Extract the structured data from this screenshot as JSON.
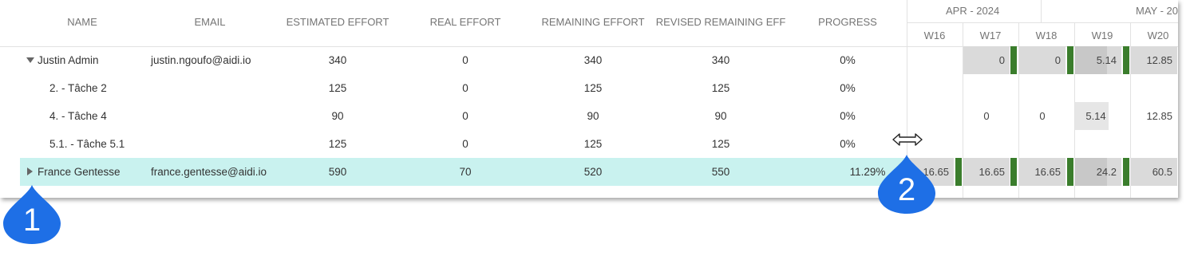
{
  "columns": {
    "name": "NAME",
    "email": "EMAIL",
    "estimated": "ESTIMATED EFFORT",
    "real": "REAL EFFORT",
    "remaining": "REMAINING EFFORT",
    "revised": "REVISED REMAINING EFF",
    "progress": "PROGRESS"
  },
  "gantt": {
    "months": [
      "APR - 2024",
      "MAY - 20"
    ],
    "weeks": [
      "W16",
      "W17",
      "W18",
      "W19",
      "W20"
    ]
  },
  "rows": [
    {
      "name": "Justin Admin",
      "email": "justin.ngoufo@aidi.io",
      "estimated": "340",
      "real": "0",
      "remaining": "340",
      "revised": "340",
      "progress": "0%",
      "gantt": [
        "",
        "0",
        "0",
        "5.14",
        "12.85"
      ]
    },
    {
      "name": "2. - Tâche 2",
      "email": "",
      "estimated": "125",
      "real": "0",
      "remaining": "125",
      "revised": "125",
      "progress": "0%",
      "gantt": [
        "",
        "",
        "",
        "",
        ""
      ]
    },
    {
      "name": "4. - Tâche 4",
      "email": "",
      "estimated": "90",
      "real": "0",
      "remaining": "90",
      "revised": "90",
      "progress": "0%",
      "gantt": [
        "",
        "0",
        "0",
        "5.14",
        "12.85"
      ]
    },
    {
      "name": "5.1. - Tâche 5.1",
      "email": "",
      "estimated": "125",
      "real": "0",
      "remaining": "125",
      "revised": "125",
      "progress": "0%",
      "gantt": [
        "",
        "",
        "",
        "",
        ""
      ]
    },
    {
      "name": "France Gentesse",
      "email": "france.gentesse@aidi.io",
      "estimated": "590",
      "real": "70",
      "remaining": "520",
      "revised": "550",
      "progress": "11.29%",
      "gantt": [
        "16.65",
        "16.65",
        "16.65",
        "24.2",
        "60.5"
      ]
    }
  ],
  "callouts": [
    "1",
    "2"
  ],
  "colors": {
    "selected_row": "#c9f2ef",
    "bar": "#3a7d2c",
    "callout": "#1e6fe6"
  }
}
